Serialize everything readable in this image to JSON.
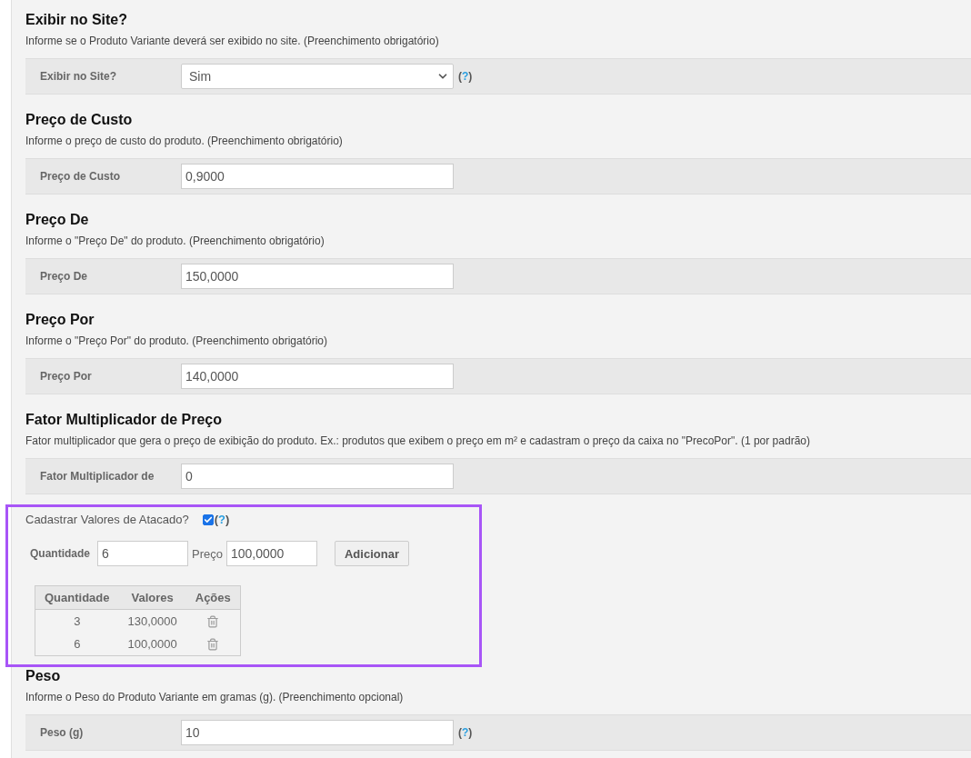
{
  "blocks": [
    {
      "kind": "select",
      "title": "Exibir no Site?",
      "description": "Informe se o Produto Variante deverá ser exibido no site. (Preenchimento obrigatório)",
      "label": "Exibir no Site?",
      "value": "Sim",
      "help": "(?)"
    },
    {
      "kind": "input",
      "title": "Preço de Custo",
      "description": "Informe o preço de custo do produto. (Preenchimento obrigatório)",
      "label": "Preço de Custo",
      "value": "0,9000"
    },
    {
      "kind": "input",
      "title": "Preço De",
      "description": "Informe o \"Preço De\" do produto. (Preenchimento obrigatório)",
      "label": "Preço De",
      "value": "150,0000"
    },
    {
      "kind": "input",
      "title": "Preço Por",
      "description": "Informe o \"Preço Por\" do produto. (Preenchimento obrigatório)",
      "label": "Preço Por",
      "value": "140,0000"
    },
    {
      "kind": "input",
      "title": "Fator Multiplicador de Preço",
      "description": "Fator multiplicador que gera o preço de exibição do produto. Ex.: produtos que exibem o preço em m² e cadastram o preço da caixa no \"PrecoPor\". (1 por padrão)",
      "label": "Fator Multiplicador de",
      "value": "0"
    },
    {
      "kind": "wholesale",
      "label": "Cadastrar Valores de Atacado?",
      "checked": true,
      "help": "(?)",
      "quantity_label": "Quantidade",
      "quantity_value": "6",
      "price_label": "Preço",
      "price_value": "100,0000",
      "button": "Adicionar",
      "columns": [
        "Quantidade",
        "Valores",
        "Ações"
      ],
      "rows": [
        {
          "quantity": "3",
          "value": "130,0000"
        },
        {
          "quantity": "6",
          "value": "100,0000"
        }
      ]
    },
    {
      "kind": "input",
      "title": "Peso",
      "description": "Informe o Peso do Produto Variante em gramas (g). (Preenchimento opcional)",
      "label": "Peso (g)",
      "value": "10",
      "help": "(?)"
    }
  ]
}
